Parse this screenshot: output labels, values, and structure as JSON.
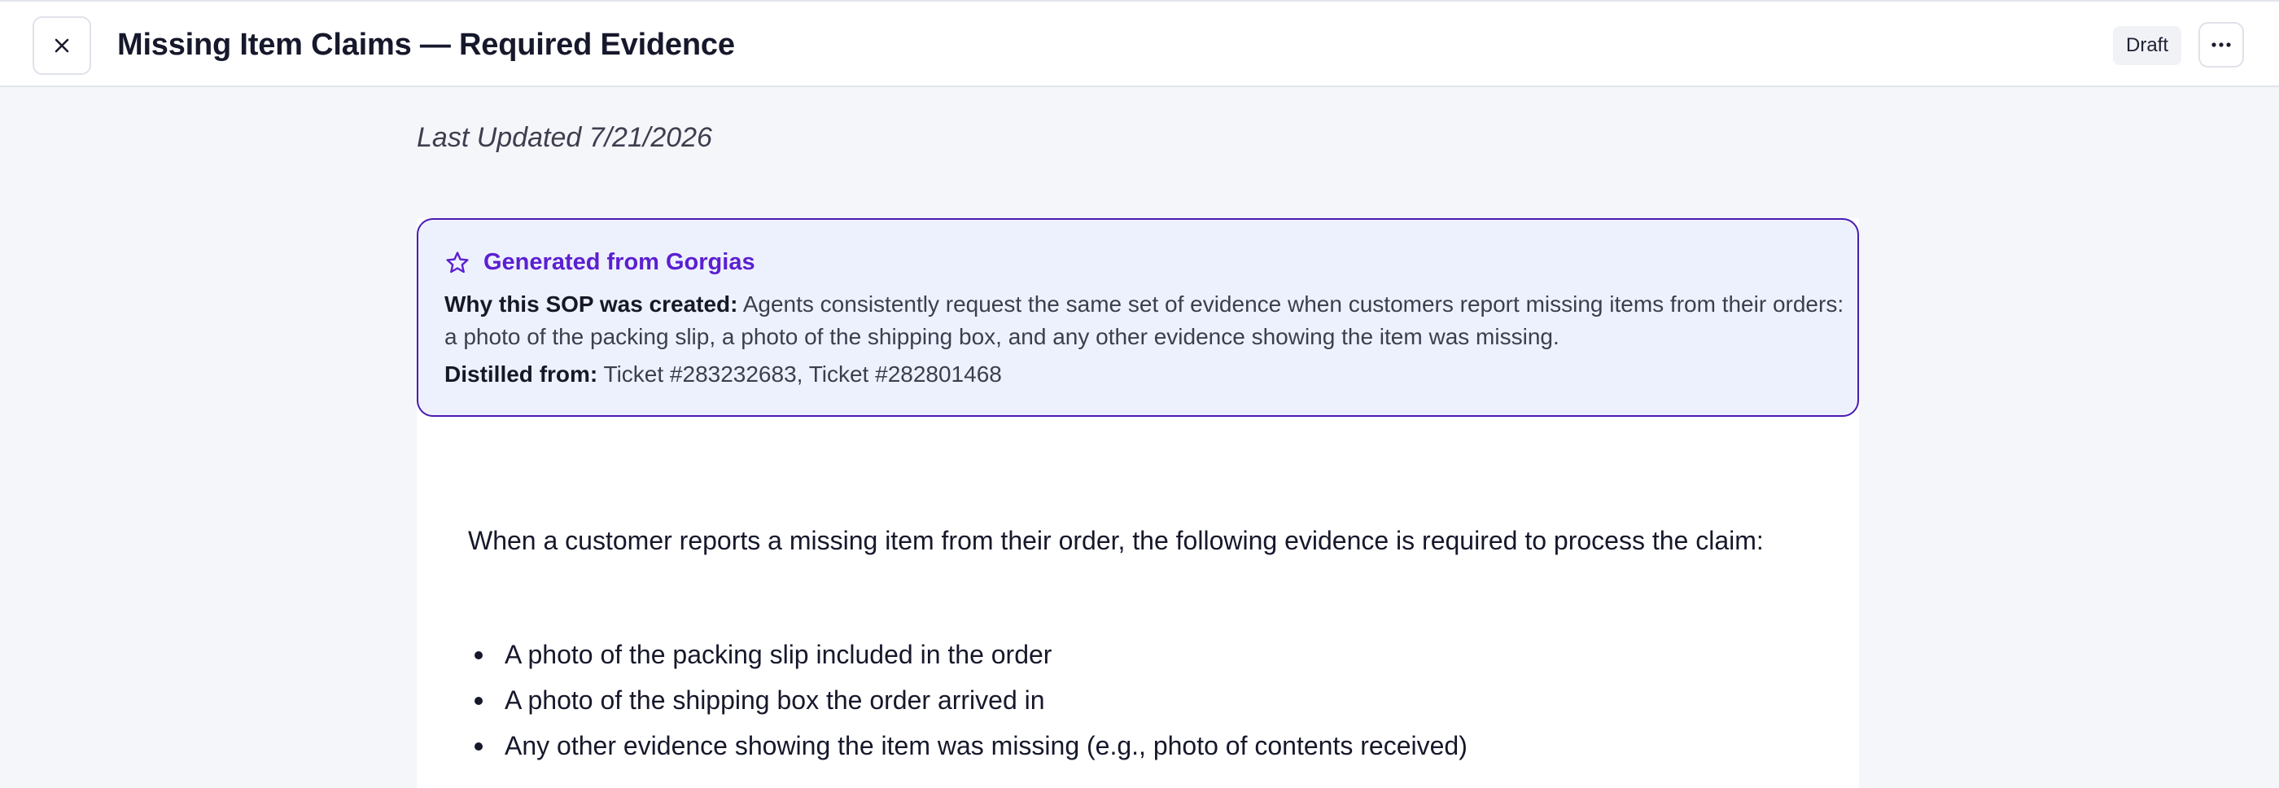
{
  "header": {
    "close_icon": "close-icon",
    "title": "Missing Item Claims — Required Evidence",
    "status": "Draft",
    "more_icon": "more-horizontal-icon"
  },
  "meta": {
    "last_updated": "Last Updated 7/21/2026"
  },
  "generated": {
    "icon": "star-icon",
    "title": "Generated from Gorgias",
    "why_label": "Why this SOP was created:",
    "why_text": " Agents consistently request the same set of evidence when customers report missing items from their orders: a photo of the packing slip, a photo of the shipping box, and any other evidence showing the item was missing.",
    "distilled_label": "Distilled from:",
    "distilled_text": " Ticket #283232683, Ticket #282801468"
  },
  "body": {
    "intro": "When a customer reports a missing item from their order, the following evidence is required to process the claim:",
    "evidence": [
      "A photo of the packing slip included in the order",
      "A photo of the shipping box the order arrived in",
      "Any other evidence showing the item was missing (e.g., photo of contents received)"
    ]
  },
  "colors": {
    "accent": "#5b1fd1",
    "box_border": "#4a1bb3",
    "box_bg": "#edf1fd",
    "page_bg": "#f5f6fa"
  }
}
